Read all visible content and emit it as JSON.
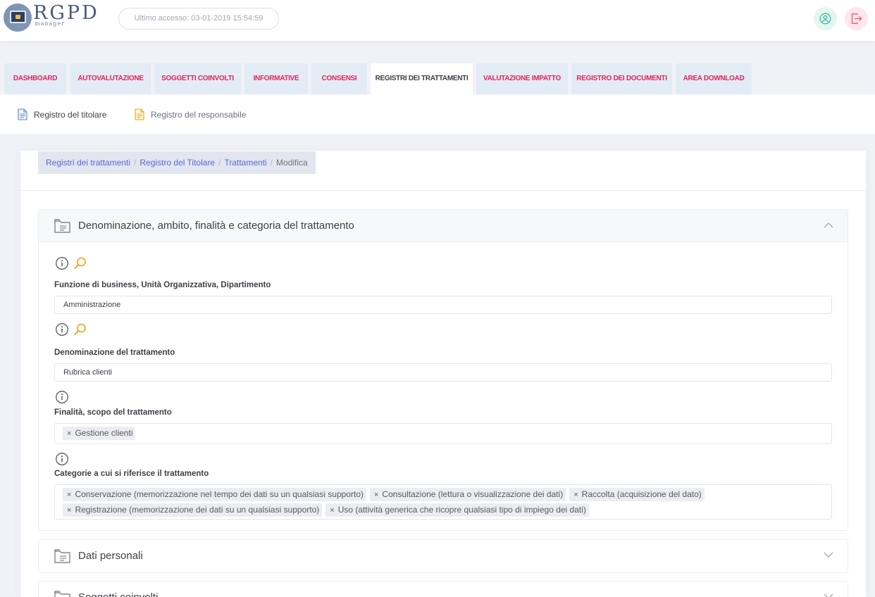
{
  "brand": {
    "name": "RGPD",
    "sub": "manager"
  },
  "header": {
    "last_access": "Ultimo accesso: 03-01-2019 15:54:59"
  },
  "tabs": [
    {
      "label": "DASHBOARD"
    },
    {
      "label": "AUTOVALUTAZIONE"
    },
    {
      "label": "SOGGETTI COINVOLTI"
    },
    {
      "label": "INFORMATIVE"
    },
    {
      "label": "CONSENSI"
    },
    {
      "label": "REGISTRI DEI TRATTAMENTI"
    },
    {
      "label": "VALUTAZIONE IMPATTO"
    },
    {
      "label": "REGISTRO DEI DOCUMENTI"
    },
    {
      "label": "AREA DOWNLOAD"
    }
  ],
  "active_tab": "REGISTRI DEI TRATTAMENTI",
  "subnav": [
    {
      "label": "Registro del titolare"
    },
    {
      "label": "Registro del responsabile"
    }
  ],
  "breadcrumb": [
    {
      "label": "Registri dei trattamenti"
    },
    {
      "label": "Registro del Titolare"
    },
    {
      "label": "Trattamenti"
    },
    {
      "label": "Modifica"
    }
  ],
  "sections": {
    "main": {
      "title": "Denominazione, ambito, finalità e categoria del trattamento"
    },
    "personal": {
      "title": "Dati personali"
    },
    "subjects": {
      "title": "Soggetti coinvolti"
    }
  },
  "fields": {
    "business_function": {
      "label": "Funzione di business, Unità Organizzativa, Dipartimento",
      "value": "Amministrazione"
    },
    "treatment_name": {
      "label": "Denominazione del trattamento",
      "value": "Rubrica clienti"
    },
    "purpose": {
      "label": "Finalità, scopo del trattamento",
      "tags": [
        "Gestione clienti"
      ]
    },
    "categories": {
      "label": "Categorie a cui si riferisce il trattamento",
      "tags": [
        "Conservazione (memorizzazione nel tempo dei dati su un qualsiasi supporto)",
        "Consultazione (lettura o visualizzazione dei dati)",
        "Raccolta (acquisizione del dato)",
        "Registrazione (memorizzazione dei dati su un qualsiasi supporto)",
        "Uso (attività generica che ricopre qualsiasi tipo di impiego dei dati)"
      ]
    }
  },
  "tag_remove_glyph": "×",
  "colors": {
    "accent": "#e0245e",
    "link": "#5867dd",
    "search_icon": "#f2a515",
    "tab_bg": "#e3ecf4"
  }
}
